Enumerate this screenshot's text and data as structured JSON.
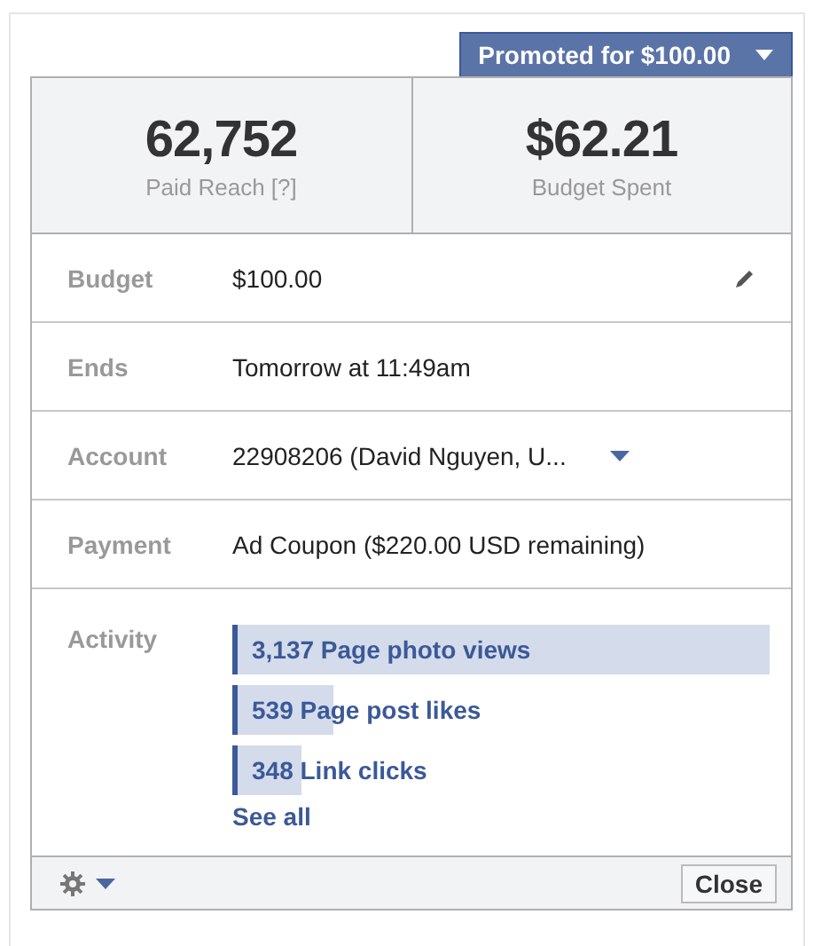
{
  "promote_button": {
    "label": "Promoted for $100.00"
  },
  "stats": [
    {
      "value": "62,752",
      "label": "Paid Reach [?]"
    },
    {
      "value": "$62.21",
      "label": "Budget Spent"
    }
  ],
  "fields": [
    {
      "label": "Budget",
      "value": "$100.00",
      "kind": "edit"
    },
    {
      "label": "Ends",
      "value": "Tomorrow at 11:49am",
      "kind": "text"
    },
    {
      "label": "Account",
      "value": "22908206 (David Nguyen, U...",
      "kind": "dropdown"
    },
    {
      "label": "Payment",
      "value": "Ad Coupon ($220.00 USD remaining)",
      "kind": "text"
    }
  ],
  "activity": {
    "label": "Activity",
    "items": [
      {
        "text": "3,137 Page photo views",
        "level": 1
      },
      {
        "text": "539 Page post likes",
        "level": 0.18
      },
      {
        "text": "348 Link clicks",
        "level": 0.12
      }
    ],
    "see_all": "See all"
  },
  "footer": {
    "close": "Close"
  }
}
